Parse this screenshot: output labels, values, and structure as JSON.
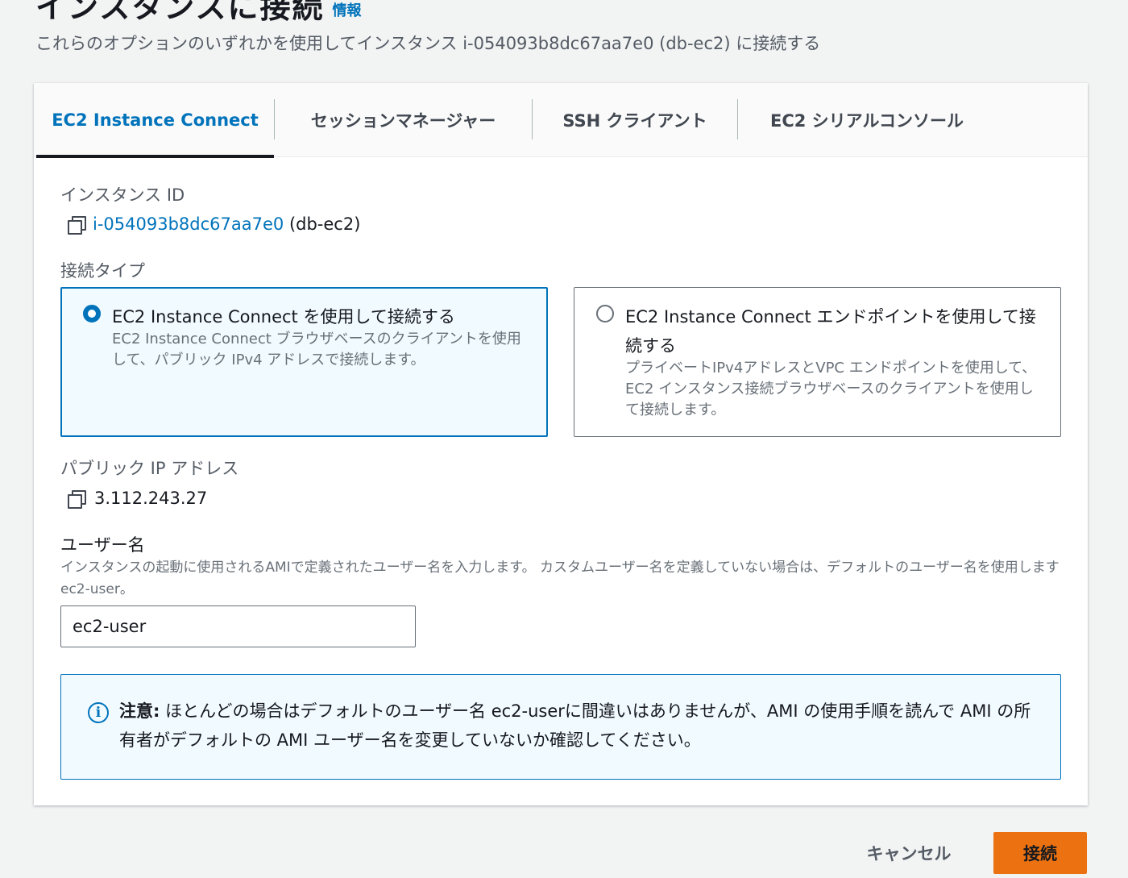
{
  "header": {
    "title": "インスタンスに接続",
    "info_link": "情報",
    "subtitle": "これらのオプションのいずれかを使用してインスタンス i-054093b8dc67aa7e0 (db-ec2) に接続する"
  },
  "tabs": [
    {
      "label": "EC2 Instance Connect",
      "active": true
    },
    {
      "label": "セッションマネージャー",
      "active": false
    },
    {
      "label": "SSH クライアント",
      "active": false
    },
    {
      "label": "EC2 シリアルコンソール",
      "active": false
    }
  ],
  "instance": {
    "label": "インスタンス ID",
    "id": "i-054093b8dc67aa7e0",
    "name": "(db-ec2)"
  },
  "connection_type": {
    "label": "接続タイプ",
    "options": [
      {
        "title": "EC2 Instance Connect を使用して接続する",
        "description": "EC2 Instance Connect ブラウザベースのクライアントを使用して、パブリック IPv4 アドレスで接続します。",
        "selected": true
      },
      {
        "title": "EC2 Instance Connect エンドポイントを使用して接続する",
        "description": "プライベートIPv4アドレスとVPC エンドポイントを使用して、EC2 インスタンス接続ブラウザベースのクライアントを使用して接続します。",
        "selected": false
      }
    ]
  },
  "public_ip": {
    "label": "パブリック IP アドレス",
    "value": "3.112.243.27"
  },
  "username": {
    "label": "ユーザー名",
    "description": "インスタンスの起動に使用されるAMIで定義されたユーザー名を入力します。 カスタムユーザー名を定義していない場合は、デフォルトのユーザー名を使用します ec2-user。",
    "value": "ec2-user"
  },
  "alert": {
    "icon": "info-icon",
    "strong": "注意:",
    "text": " ほとんどの場合はデフォルトのユーザー名 ec2-userに間違いはありませんが、AMI の使用手順を読んで AMI の所有者がデフォルトの AMI ユーザー名を変更していないか確認してください。"
  },
  "footer": {
    "cancel_label": "キャンセル",
    "connect_label": "接続"
  },
  "colors": {
    "primary": "#0073bb",
    "accent_button": "#ec7211",
    "selected_bg": "#f1faff"
  }
}
